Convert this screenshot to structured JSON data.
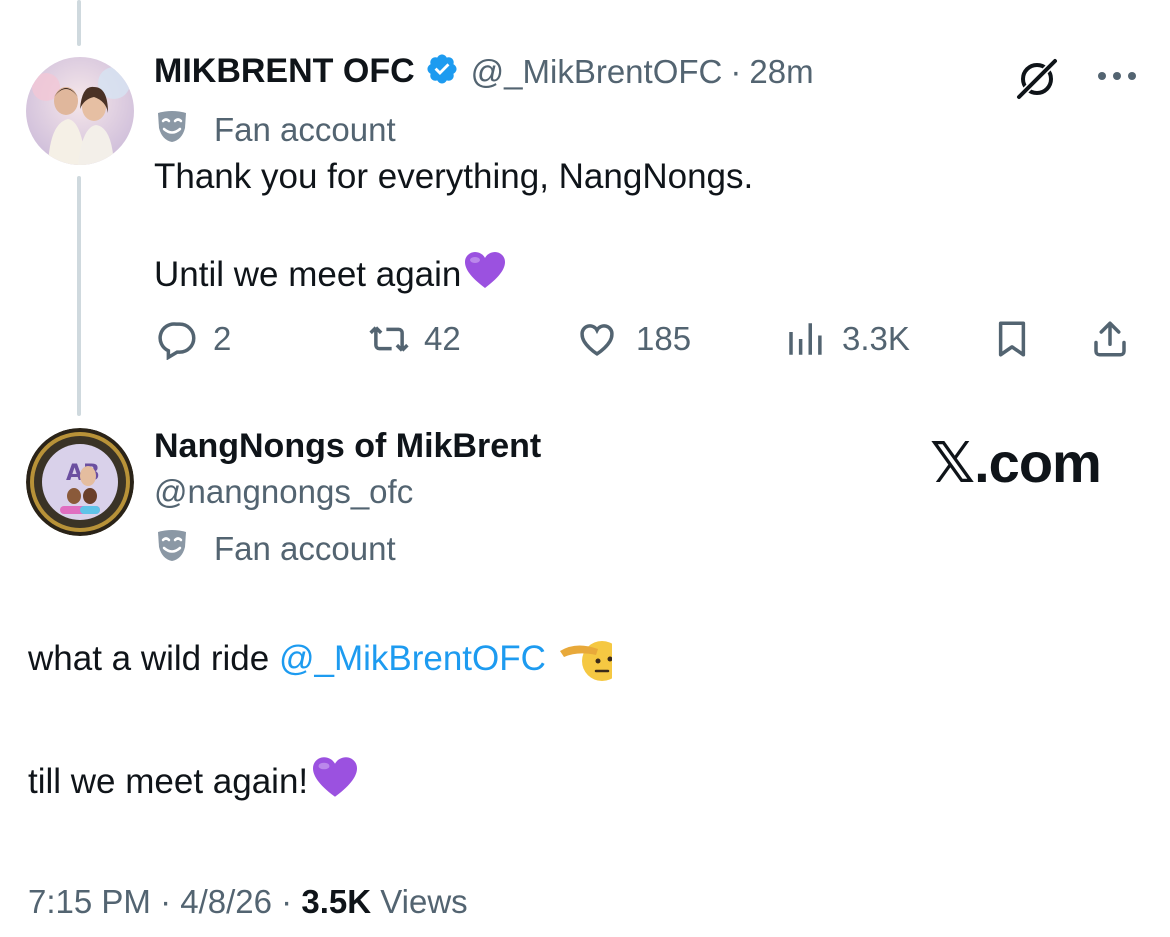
{
  "parent_tweet": {
    "display_name": "MIKBRENT OFC",
    "handle": "@_MikBrentOFC",
    "separator": "·",
    "time": "28m",
    "label": "Fan account",
    "text_line1": "Thank you for everything, NangNongs.",
    "text_line2": "Until we meet again",
    "icons": [
      "verified-badge-icon",
      "grok-icon",
      "more-icon",
      "fan-mask-icon"
    ],
    "metrics": {
      "replies": "2",
      "reposts": "42",
      "likes": "185",
      "views": "3.3K"
    }
  },
  "reply_tweet": {
    "display_name": "NangNongs of MikBrent",
    "handle": "@nangnongs_ofc",
    "label": "Fan account",
    "text_line1_prefix": "what a wild ride ",
    "text_line1_mention": "@_MikBrentOFC",
    "text_line2": "till we meet again!",
    "time": "7:15 PM",
    "date": "4/8/26",
    "views_count": "3.5K",
    "views_label": "Views",
    "sep": "·"
  },
  "watermark": "𝕏.com",
  "colors": {
    "accent": "#1d9bf0",
    "text": "#0f1419",
    "secondary": "#536471",
    "heart_emoji": "#9b51e0"
  }
}
